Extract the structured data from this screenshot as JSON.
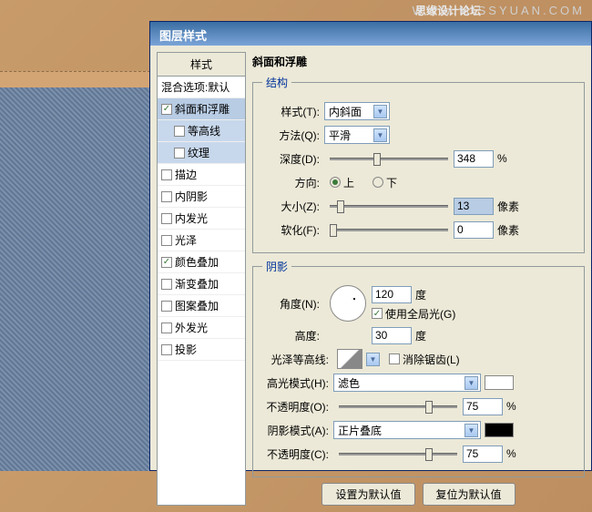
{
  "watermark": {
    "site": "WWW.MISSYUAN.COM",
    "forum": "思缘设计论坛"
  },
  "dialog": {
    "title": "图层样式",
    "styles_header": "样式",
    "styles": [
      {
        "label": "混合选项:默认",
        "checked": false,
        "nocheck": true
      },
      {
        "label": "斜面和浮雕",
        "checked": true,
        "active": true
      },
      {
        "label": "等高线",
        "checked": false,
        "indent": true,
        "subactive": true
      },
      {
        "label": "纹理",
        "checked": false,
        "indent": true,
        "subactive": true
      },
      {
        "label": "描边",
        "checked": false
      },
      {
        "label": "内阴影",
        "checked": false
      },
      {
        "label": "内发光",
        "checked": false
      },
      {
        "label": "光泽",
        "checked": false
      },
      {
        "label": "颜色叠加",
        "checked": true
      },
      {
        "label": "渐变叠加",
        "checked": false
      },
      {
        "label": "图案叠加",
        "checked": false
      },
      {
        "label": "外发光",
        "checked": false
      },
      {
        "label": "投影",
        "checked": false
      }
    ]
  },
  "bevel": {
    "panel_title": "斜面和浮雕",
    "structure": "结构",
    "style_lbl": "样式(T):",
    "style_val": "内斜面",
    "tech_lbl": "方法(Q):",
    "tech_val": "平滑",
    "depth_lbl": "深度(D):",
    "depth_val": "348",
    "depth_unit": "%",
    "dir_lbl": "方向:",
    "dir_up": "上",
    "dir_down": "下",
    "size_lbl": "大小(Z):",
    "size_val": "13",
    "size_unit": "像素",
    "soft_lbl": "软化(F):",
    "soft_val": "0",
    "soft_unit": "像素"
  },
  "shade": {
    "title": "阴影",
    "angle_lbl": "角度(N):",
    "angle_val": "120",
    "angle_unit": "度",
    "global": "使用全局光(G)",
    "alt_lbl": "高度:",
    "alt_val": "30",
    "alt_unit": "度",
    "contour_lbl": "光泽等高线:",
    "aa": "消除锯齿(L)",
    "hmode_lbl": "高光模式(H):",
    "hmode_val": "滤色",
    "hop_lbl": "不透明度(O):",
    "hop_val": "75",
    "hop_unit": "%",
    "smode_lbl": "阴影模式(A):",
    "smode_val": "正片叠底",
    "sop_lbl": "不透明度(C):",
    "sop_val": "75",
    "sop_unit": "%"
  },
  "buttons": {
    "default": "设置为默认值",
    "reset": "复位为默认值"
  }
}
